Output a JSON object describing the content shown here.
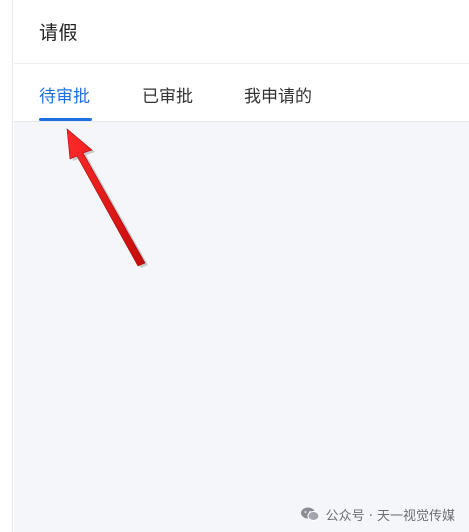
{
  "header": {
    "title": "请假"
  },
  "tabs": [
    {
      "label": "待审批",
      "active": true
    },
    {
      "label": "已审批",
      "active": false
    },
    {
      "label": "我申请的",
      "active": false
    }
  ],
  "watermark": {
    "text": "公众号 · 天一视觉传媒",
    "icon": "wechat-icon"
  },
  "colors": {
    "accent": "#1f6fe0",
    "content_bg": "#f4f6fa",
    "annotation_arrow": "#e01f1f"
  }
}
